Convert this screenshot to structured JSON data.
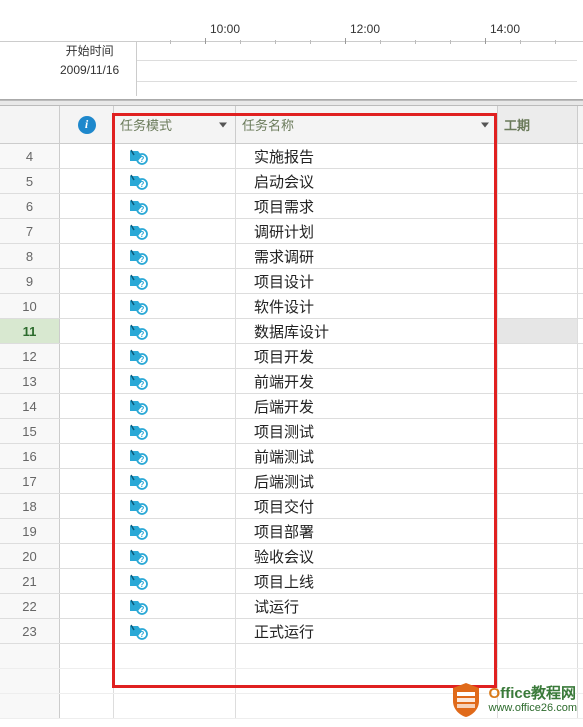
{
  "timeline": {
    "start_label": "开始时间",
    "start_date": "2009/11/16",
    "ticks": [
      "10:00",
      "12:00",
      "14:00"
    ]
  },
  "headers": {
    "mode": "任务模式",
    "name": "任务名称",
    "duration": "工期"
  },
  "selected_row": 11,
  "rows": [
    {
      "num": "4",
      "name": "实施报告"
    },
    {
      "num": "5",
      "name": "启动会议"
    },
    {
      "num": "6",
      "name": "项目需求"
    },
    {
      "num": "7",
      "name": "调研计划"
    },
    {
      "num": "8",
      "name": "需求调研"
    },
    {
      "num": "9",
      "name": "项目设计"
    },
    {
      "num": "10",
      "name": "软件设计"
    },
    {
      "num": "11",
      "name": "数据库设计"
    },
    {
      "num": "12",
      "name": "项目开发"
    },
    {
      "num": "13",
      "name": "前端开发"
    },
    {
      "num": "14",
      "name": "后端开发"
    },
    {
      "num": "15",
      "name": "项目测试"
    },
    {
      "num": "16",
      "name": "前端测试"
    },
    {
      "num": "17",
      "name": "后端测试"
    },
    {
      "num": "18",
      "name": "项目交付"
    },
    {
      "num": "19",
      "name": "项目部署"
    },
    {
      "num": "20",
      "name": "验收会议"
    },
    {
      "num": "21",
      "name": "项目上线"
    },
    {
      "num": "22",
      "name": "试运行"
    },
    {
      "num": "23",
      "name": "正式运行"
    }
  ],
  "watermark": {
    "line1_prefix": "O",
    "line1_rest": "ffice教程网",
    "line2": "www.office26.com"
  },
  "colors": {
    "highlight_red": "#e02020",
    "task_blue": "#2aa8d6",
    "header_text": "#6a7a5a"
  }
}
